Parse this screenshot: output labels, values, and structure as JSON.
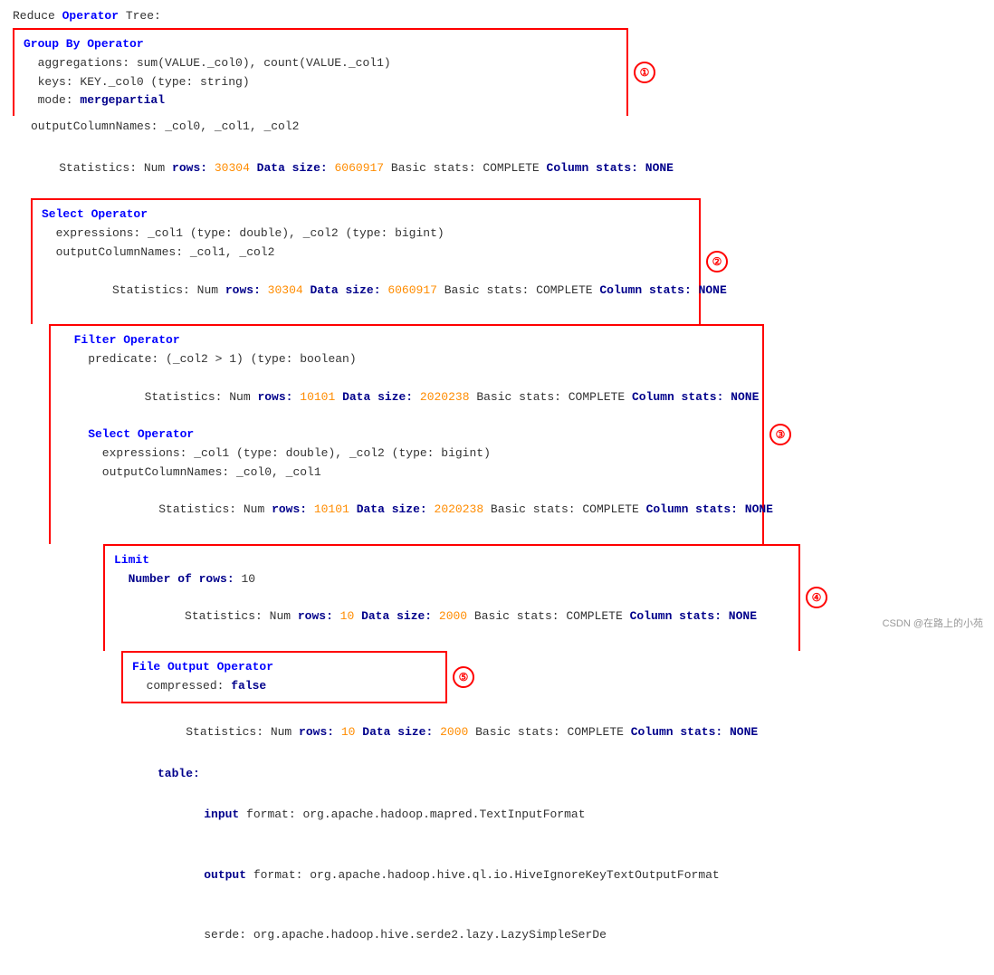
{
  "title": {
    "prefix": "Reduce ",
    "keyword": "Operator",
    "suffix": " Tree:"
  },
  "blocks": [
    {
      "id": "block1",
      "circleNum": "①",
      "indent": 0,
      "lines": [
        {
          "parts": [
            {
              "text": "Group By Operator",
              "cls": "blue-bold"
            }
          ]
        },
        {
          "parts": [
            {
              "text": "  aggregations: sum(VALUE._col0), count(VALUE._col1)",
              "cls": "plain"
            }
          ]
        },
        {
          "parts": [
            {
              "text": "  keys: KEY._col0 (type: string)",
              "cls": "plain"
            }
          ]
        },
        {
          "parts": [
            {
              "text": "  mode: ",
              "cls": "plain"
            },
            {
              "text": "mergepartial",
              "cls": "dark-blue-bold"
            }
          ]
        }
      ]
    },
    {
      "id": "noline1",
      "lines": [
        {
          "text": "  outputColumnNames: _col0, _col1, _col2",
          "cls": "plain"
        },
        {
          "text": "  Statistics: Num rows: 30304 Data size: 6060917 Basic stats: COMPLETE Column stats: NONE",
          "special": "stats1"
        }
      ]
    },
    {
      "id": "block2",
      "circleNum": "②",
      "indent": 20,
      "lines": [
        {
          "parts": [
            {
              "text": "Select Operator",
              "cls": "blue-bold"
            }
          ]
        },
        {
          "parts": [
            {
              "text": "  expressions: _col1 (type: double), _col2 (type: bigint)",
              "cls": "plain"
            }
          ]
        },
        {
          "parts": [
            {
              "text": "  outputColumnNames: _col1, _col2",
              "cls": "plain"
            }
          ]
        },
        {
          "parts": [
            {
              "text": "  Statistics: Num rows: ",
              "cls": "plain"
            },
            {
              "text": "30304",
              "cls": "orange"
            },
            {
              "text": " Data size: ",
              "cls": "dark-blue-bold"
            },
            {
              "text": "6060917",
              "cls": "orange"
            },
            {
              "text": " Basic stats: COMPLETE Column stats: NONE",
              "cls": "plain"
            }
          ]
        }
      ]
    },
    {
      "id": "block3",
      "circleNum": "③",
      "indent": 40,
      "lines": [
        {
          "parts": [
            {
              "text": "  Filter Operator",
              "cls": "blue-bold"
            }
          ]
        },
        {
          "parts": [
            {
              "text": "    predicate: (_col2 > 1) (type: boolean)",
              "cls": "plain"
            }
          ]
        },
        {
          "parts": [
            {
              "text": "    Statistics: Num rows: ",
              "cls": "plain"
            },
            {
              "text": "10101",
              "cls": "orange"
            },
            {
              "text": " Data size: ",
              "cls": "dark-blue-bold"
            },
            {
              "text": "2020238",
              "cls": "orange"
            },
            {
              "text": " Basic stats: COMPLETE Column stats: NONE",
              "cls": "plain"
            }
          ]
        },
        {
          "parts": [
            {
              "text": "    Select Operator",
              "cls": "blue-bold"
            }
          ]
        },
        {
          "parts": [
            {
              "text": "      expressions: _col1 (type: double), _col2 (type: bigint)",
              "cls": "plain"
            }
          ]
        },
        {
          "parts": [
            {
              "text": "      outputColumnNames: _col0, _col1",
              "cls": "plain"
            }
          ]
        },
        {
          "parts": [
            {
              "text": "      Statistics: Num rows: ",
              "cls": "plain"
            },
            {
              "text": "10101",
              "cls": "orange"
            },
            {
              "text": " Data size: ",
              "cls": "dark-blue-bold"
            },
            {
              "text": "2020238",
              "cls": "orange"
            },
            {
              "text": " Basic stats: COMPLETE Column stats: NONE",
              "cls": "plain"
            }
          ]
        }
      ]
    },
    {
      "id": "block4",
      "circleNum": "④",
      "indent": 100,
      "lines": [
        {
          "parts": [
            {
              "text": "Limit",
              "cls": "blue-bold"
            }
          ]
        },
        {
          "parts": [
            {
              "text": "  Number of rows: ",
              "cls": "dark-blue-bold"
            },
            {
              "text": "10",
              "cls": "plain"
            }
          ]
        },
        {
          "parts": [
            {
              "text": "  Statistics: Num rows: ",
              "cls": "plain"
            },
            {
              "text": "10",
              "cls": "orange"
            },
            {
              "text": " Data size: ",
              "cls": "dark-blue-bold"
            },
            {
              "text": "2000",
              "cls": "orange"
            },
            {
              "text": " Basic stats: COMPLETE Column stats: NONE",
              "cls": "plain"
            }
          ]
        }
      ]
    },
    {
      "id": "block5",
      "circleNum": "⑤",
      "indent": 120,
      "lines": [
        {
          "parts": [
            {
              "text": "File Output Operator",
              "cls": "blue-bold"
            }
          ]
        },
        {
          "parts": [
            {
              "text": "  compressed: ",
              "cls": "plain"
            },
            {
              "text": "false",
              "cls": "dark-blue-bold"
            }
          ]
        }
      ]
    },
    {
      "id": "noline2",
      "lines": [
        {
          "text": "        Statistics: Num rows: 10 Data size: 2000 Basic stats: COMPLETE Column stats: NONE",
          "special": "stats2"
        },
        {
          "text": "        table:",
          "cls": "dark-blue-bold"
        },
        {
          "text": "          input format: org.apache.hadoop.mapred.TextInputFormat",
          "cls": "plain"
        },
        {
          "text": "          output format: org.apache.hadoop.hive.ql.io.HiveIgnoreKeyTextOutputFormat",
          "cls": "plain"
        },
        {
          "text": "          serde: org.apache.hadoop.hive.serde2.lazy.LazySimpleSerDe",
          "cls": "plain"
        }
      ]
    }
  ],
  "watermark": "CSDN @在路上的小苑"
}
